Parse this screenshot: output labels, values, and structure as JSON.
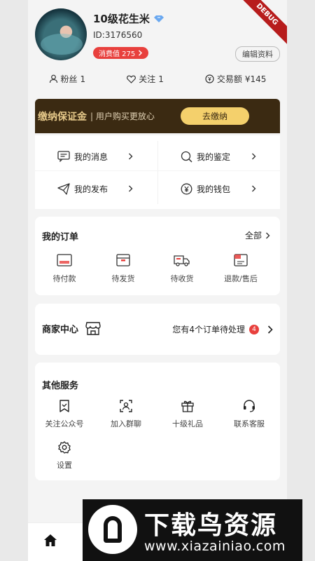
{
  "debug_banner": "DEBUG",
  "profile": {
    "name": "10级花生米",
    "id_text": "ID:3176560",
    "vip_label": "消费值 275",
    "edit_label": "编辑资料"
  },
  "stats": {
    "fans_label": "粉丝",
    "fans_count": "1",
    "follow_label": "关注",
    "follow_count": "1",
    "trade_label": "交易额",
    "trade_amount": "¥145"
  },
  "deposit": {
    "title": "缴纳保证金",
    "desc": "| 用户购买更放心",
    "button": "去缴纳"
  },
  "quick_menu": [
    {
      "label": "我的消息",
      "icon": "message-icon"
    },
    {
      "label": "我的鉴定",
      "icon": "search-check-icon"
    },
    {
      "label": "我的发布",
      "icon": "send-icon"
    },
    {
      "label": "我的钱包",
      "icon": "wallet-icon"
    }
  ],
  "orders": {
    "title": "我的订单",
    "all_label": "全部",
    "items": [
      {
        "label": "待付款",
        "icon": "card-icon"
      },
      {
        "label": "待发货",
        "icon": "box-icon"
      },
      {
        "label": "待收货",
        "icon": "truck-icon"
      },
      {
        "label": "退款/售后",
        "icon": "refund-icon"
      }
    ]
  },
  "merchant": {
    "title": "商家中心",
    "status_text": "您有4个订单待处理",
    "badge": "4"
  },
  "services": {
    "title": "其他服务",
    "items": [
      {
        "label": "关注公众号",
        "icon": "bookmark-icon"
      },
      {
        "label": "加入群聊",
        "icon": "scan-user-icon"
      },
      {
        "label": "十级礼品",
        "icon": "gift-icon"
      },
      {
        "label": "联系客服",
        "icon": "headset-icon"
      },
      {
        "label": "设置",
        "icon": "gear-icon"
      }
    ]
  },
  "watermark": {
    "title": "下载鸟资源",
    "url": "www.xiazainiao.com"
  },
  "colors": {
    "accent_red": "#e8403d",
    "deposit_bg": "#3b2a12",
    "deposit_btn": "#f4d06c"
  }
}
